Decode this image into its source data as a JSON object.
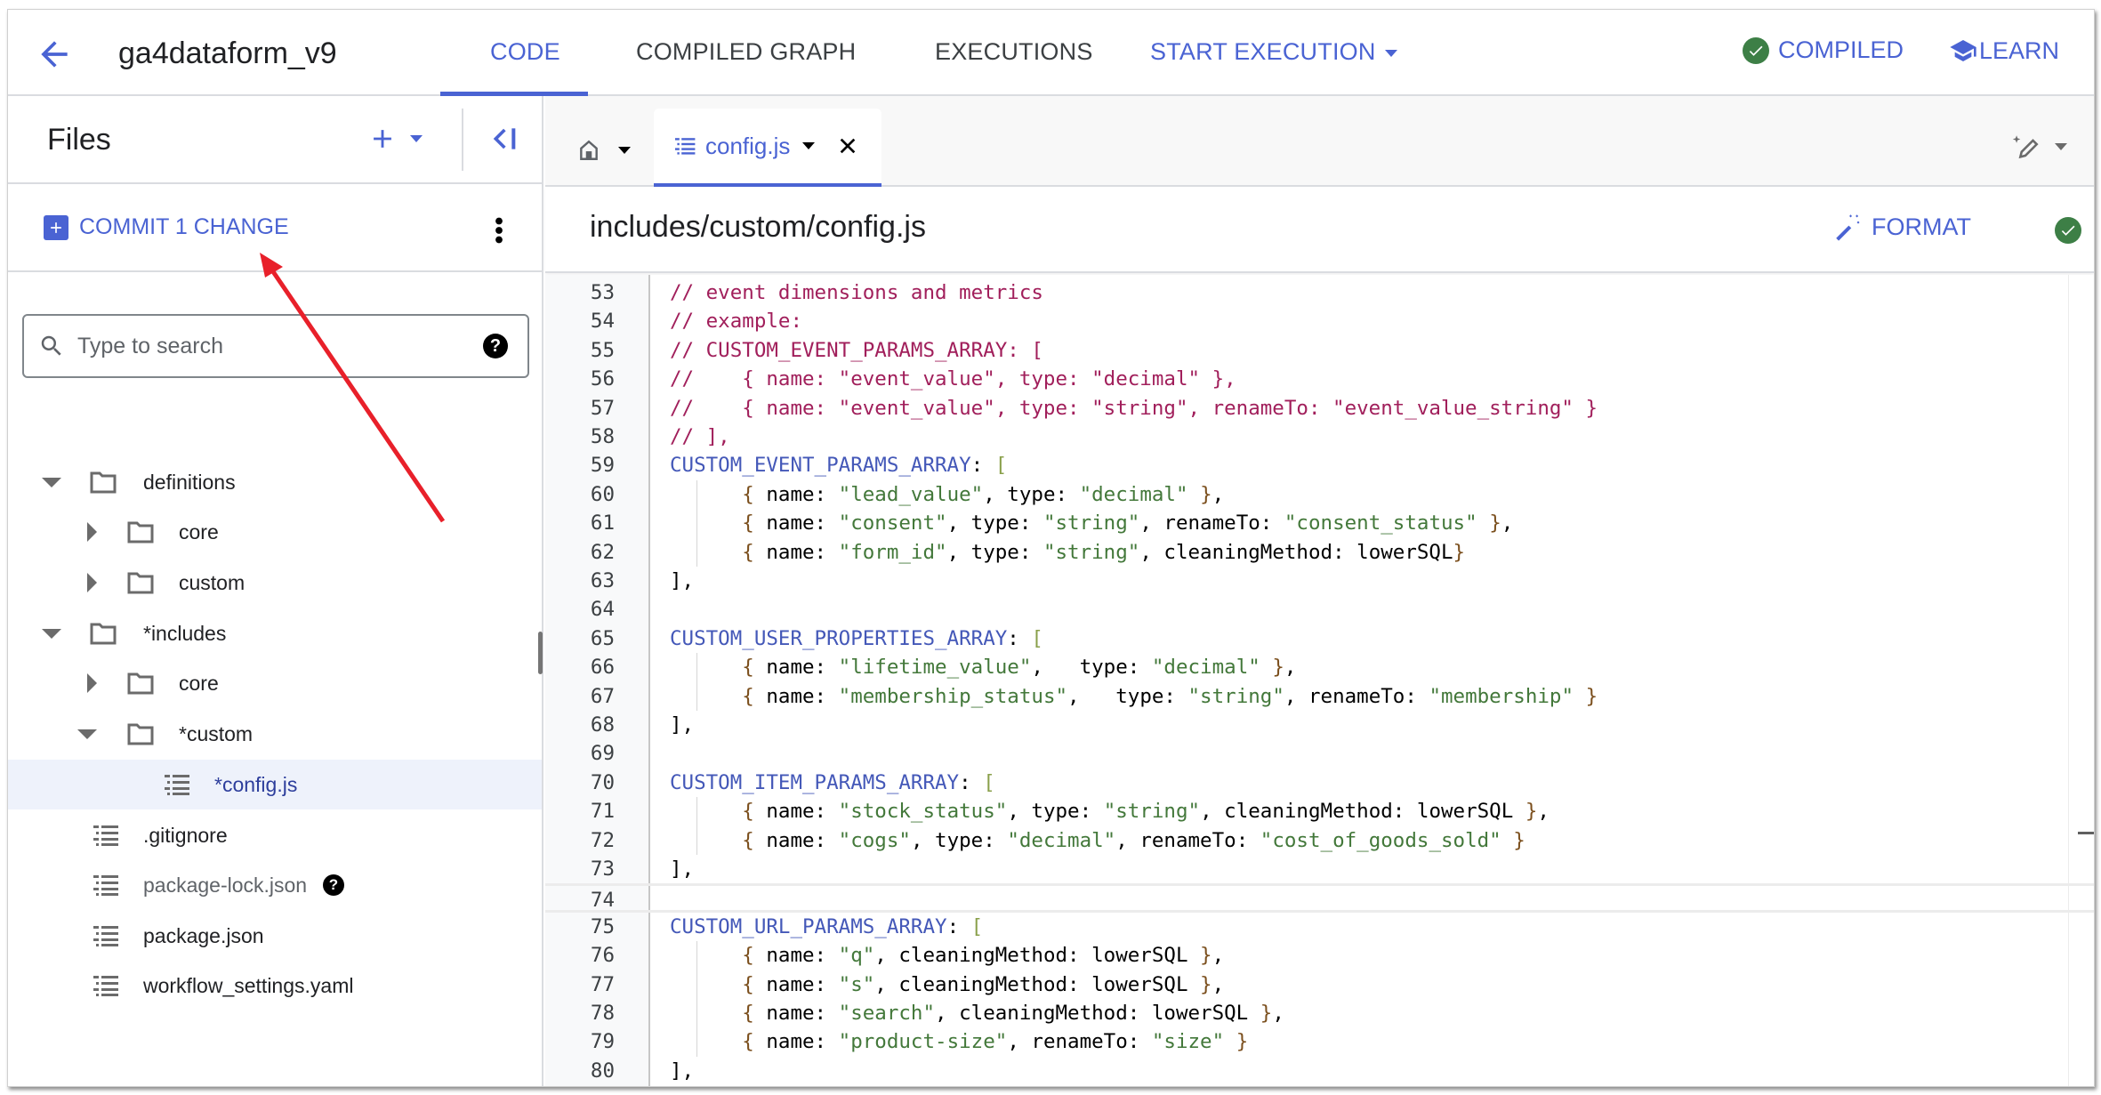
{
  "header": {
    "back_icon": "arrow-back-icon",
    "repo_name": "ga4dataform_v9",
    "tabs": [
      {
        "label": "CODE",
        "active": true
      },
      {
        "label": "COMPILED GRAPH",
        "active": false
      },
      {
        "label": "EXECUTIONS",
        "active": false
      }
    ],
    "start_execution_label": "START EXECUTION",
    "compiled_label": "COMPILED",
    "learn_label": "LEARN",
    "accent_color": "#4a63d3",
    "success_color": "#3d7f46"
  },
  "files_panel": {
    "title": "Files",
    "commit_label": "COMMIT 1 CHANGE",
    "search_placeholder": "Type to search",
    "tree": [
      {
        "label": "definitions",
        "type": "folder",
        "depth": 0,
        "expanded": true
      },
      {
        "label": "core",
        "type": "folder",
        "depth": 1,
        "expanded": false
      },
      {
        "label": "custom",
        "type": "folder",
        "depth": 1,
        "expanded": false
      },
      {
        "label": "*includes",
        "type": "folder",
        "depth": 0,
        "expanded": true
      },
      {
        "label": "core",
        "type": "folder",
        "depth": 1,
        "expanded": false
      },
      {
        "label": "*custom",
        "type": "folder",
        "depth": 1,
        "expanded": true
      },
      {
        "label": "*config.js",
        "type": "file",
        "depth": 2,
        "selected": true
      },
      {
        "label": ".gitignore",
        "type": "file",
        "depth": 0
      },
      {
        "label": "package-lock.json",
        "type": "file",
        "depth": 0,
        "dimmed": true,
        "help": true
      },
      {
        "label": "package.json",
        "type": "file",
        "depth": 0
      },
      {
        "label": "workflow_settings.yaml",
        "type": "file",
        "depth": 0
      }
    ]
  },
  "editor": {
    "open_tab": "config.js",
    "file_path": "includes/custom/config.js",
    "format_label": "FORMAT",
    "current_line": 74,
    "lines": [
      {
        "n": 53,
        "t": [
          [
            "c",
            "// event dimensions and metrics"
          ]
        ]
      },
      {
        "n": 54,
        "t": [
          [
            "c",
            "// example:"
          ]
        ]
      },
      {
        "n": 55,
        "t": [
          [
            "c",
            "// CUSTOM_EVENT_PARAMS_ARRAY: ["
          ]
        ]
      },
      {
        "n": 56,
        "t": [
          [
            "c",
            "//    { name: \"event_value\", type: \"decimal\" },"
          ]
        ]
      },
      {
        "n": 57,
        "t": [
          [
            "c",
            "//    { name: \"event_value\", type: \"string\", renameTo: \"event_value_string\" }"
          ]
        ]
      },
      {
        "n": 58,
        "t": [
          [
            "c",
            "// ],"
          ]
        ]
      },
      {
        "n": 59,
        "t": [
          [
            "k",
            "CUSTOM_EVENT_PARAMS_ARRAY"
          ],
          [
            "p",
            ": "
          ],
          [
            "b",
            "["
          ]
        ]
      },
      {
        "n": 60,
        "t": [
          [
            "p",
            "      "
          ],
          [
            "r",
            "{"
          ],
          [
            "p",
            " name: "
          ],
          [
            "s",
            "\"lead_value\""
          ],
          [
            "p",
            ", type: "
          ],
          [
            "s",
            "\"decimal\""
          ],
          [
            "p",
            " "
          ],
          [
            "r",
            "}"
          ],
          [
            "p",
            ","
          ]
        ]
      },
      {
        "n": 61,
        "t": [
          [
            "p",
            "      "
          ],
          [
            "r",
            "{"
          ],
          [
            "p",
            " name: "
          ],
          [
            "s",
            "\"consent\""
          ],
          [
            "p",
            ", type: "
          ],
          [
            "s",
            "\"string\""
          ],
          [
            "p",
            ", renameTo: "
          ],
          [
            "s",
            "\"consent_status\""
          ],
          [
            "p",
            " "
          ],
          [
            "r",
            "}"
          ],
          [
            "p",
            ","
          ]
        ]
      },
      {
        "n": 62,
        "t": [
          [
            "p",
            "      "
          ],
          [
            "r",
            "{"
          ],
          [
            "p",
            " name: "
          ],
          [
            "s",
            "\"form_id\""
          ],
          [
            "p",
            ", type: "
          ],
          [
            "s",
            "\"string\""
          ],
          [
            "p",
            ", cleaningMethod: lowerSQL"
          ],
          [
            "r",
            "}"
          ]
        ]
      },
      {
        "n": 63,
        "t": [
          [
            "p",
            "],"
          ]
        ]
      },
      {
        "n": 64,
        "t": []
      },
      {
        "n": 65,
        "t": [
          [
            "k",
            "CUSTOM_USER_PROPERTIES_ARRAY"
          ],
          [
            "p",
            ": "
          ],
          [
            "b",
            "["
          ]
        ]
      },
      {
        "n": 66,
        "t": [
          [
            "p",
            "      "
          ],
          [
            "r",
            "{"
          ],
          [
            "p",
            " name: "
          ],
          [
            "s",
            "\"lifetime_value\""
          ],
          [
            "p",
            ",   type: "
          ],
          [
            "s",
            "\"decimal\""
          ],
          [
            "p",
            " "
          ],
          [
            "r",
            "}"
          ],
          [
            "p",
            ","
          ]
        ]
      },
      {
        "n": 67,
        "t": [
          [
            "p",
            "      "
          ],
          [
            "r",
            "{"
          ],
          [
            "p",
            " name: "
          ],
          [
            "s",
            "\"membership_status\""
          ],
          [
            "p",
            ",   type: "
          ],
          [
            "s",
            "\"string\""
          ],
          [
            "p",
            ", renameTo: "
          ],
          [
            "s",
            "\"membership\""
          ],
          [
            "p",
            " "
          ],
          [
            "r",
            "}"
          ]
        ]
      },
      {
        "n": 68,
        "t": [
          [
            "p",
            "],"
          ]
        ]
      },
      {
        "n": 69,
        "t": []
      },
      {
        "n": 70,
        "t": [
          [
            "k",
            "CUSTOM_ITEM_PARAMS_ARRAY"
          ],
          [
            "p",
            ": "
          ],
          [
            "b",
            "["
          ]
        ]
      },
      {
        "n": 71,
        "t": [
          [
            "p",
            "      "
          ],
          [
            "r",
            "{"
          ],
          [
            "p",
            " name: "
          ],
          [
            "s",
            "\"stock_status\""
          ],
          [
            "p",
            ", type: "
          ],
          [
            "s",
            "\"string\""
          ],
          [
            "p",
            ", cleaningMethod: lowerSQL "
          ],
          [
            "r",
            "}"
          ],
          [
            "p",
            ","
          ]
        ]
      },
      {
        "n": 72,
        "t": [
          [
            "p",
            "      "
          ],
          [
            "r",
            "{"
          ],
          [
            "p",
            " name: "
          ],
          [
            "s",
            "\"cogs\""
          ],
          [
            "p",
            ", type: "
          ],
          [
            "s",
            "\"decimal\""
          ],
          [
            "p",
            ", renameTo: "
          ],
          [
            "s",
            "\"cost_of_goods_sold\""
          ],
          [
            "p",
            " "
          ],
          [
            "r",
            "}"
          ]
        ]
      },
      {
        "n": 73,
        "t": [
          [
            "p",
            "],"
          ]
        ]
      },
      {
        "n": 74,
        "t": []
      },
      {
        "n": 75,
        "t": [
          [
            "k",
            "CUSTOM_URL_PARAMS_ARRAY"
          ],
          [
            "p",
            ": "
          ],
          [
            "b",
            "["
          ]
        ]
      },
      {
        "n": 76,
        "t": [
          [
            "p",
            "      "
          ],
          [
            "r",
            "{"
          ],
          [
            "p",
            " name: "
          ],
          [
            "s",
            "\"q\""
          ],
          [
            "p",
            ", cleaningMethod: lowerSQL "
          ],
          [
            "r",
            "}"
          ],
          [
            "p",
            ","
          ]
        ]
      },
      {
        "n": 77,
        "t": [
          [
            "p",
            "      "
          ],
          [
            "r",
            "{"
          ],
          [
            "p",
            " name: "
          ],
          [
            "s",
            "\"s\""
          ],
          [
            "p",
            ", cleaningMethod: lowerSQL "
          ],
          [
            "r",
            "}"
          ],
          [
            "p",
            ","
          ]
        ]
      },
      {
        "n": 78,
        "t": [
          [
            "p",
            "      "
          ],
          [
            "r",
            "{"
          ],
          [
            "p",
            " name: "
          ],
          [
            "s",
            "\"search\""
          ],
          [
            "p",
            ", cleaningMethod: lowerSQL "
          ],
          [
            "r",
            "}"
          ],
          [
            "p",
            ","
          ]
        ]
      },
      {
        "n": 79,
        "t": [
          [
            "p",
            "      "
          ],
          [
            "r",
            "{"
          ],
          [
            "p",
            " name: "
          ],
          [
            "s",
            "\"product-size\""
          ],
          [
            "p",
            ", renameTo: "
          ],
          [
            "s",
            "\"size\""
          ],
          [
            "p",
            " "
          ],
          [
            "r",
            "}"
          ]
        ]
      },
      {
        "n": 80,
        "t": [
          [
            "p",
            "],"
          ]
        ]
      }
    ],
    "syntax_colors": {
      "comment": "#a11f5b",
      "key": "#4458b8",
      "string": "#43783a",
      "brace": "#7b4f1d",
      "bracket": "#8aa04b"
    }
  },
  "annotation": {
    "type": "red-arrow",
    "points_to": "commit-button",
    "color": "#e8202a"
  }
}
